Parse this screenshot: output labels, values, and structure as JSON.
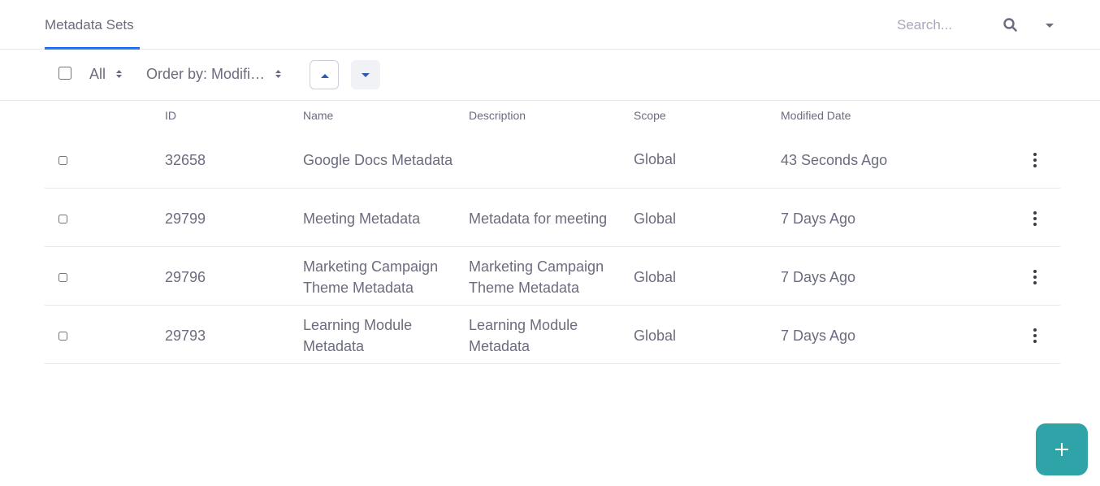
{
  "nav": {
    "tab_label": "Metadata Sets",
    "search_placeholder": "Search..."
  },
  "toolbar": {
    "filter_label": "All",
    "order_label": "Order by: Modifi…"
  },
  "table": {
    "headers": {
      "id": "ID",
      "name": "Name",
      "description": "Description",
      "scope": "Scope",
      "modified": "Modified Date"
    },
    "rows": [
      {
        "id": "32658",
        "name_line1": "Google Docs Metadata",
        "name_line2": "",
        "desc_line1": "",
        "desc_line2": "",
        "scope": "Global",
        "modified": "43 Seconds Ago"
      },
      {
        "id": "29799",
        "name_line1": "Meeting Metadata",
        "name_line2": "",
        "desc_line1": "Metadata for meeting",
        "desc_line2": "",
        "scope": "Global",
        "modified": "7 Days Ago"
      },
      {
        "id": "29796",
        "name_line1": "Marketing Campaign",
        "name_line2": "Theme Metadata",
        "desc_line1": "Marketing Campaign",
        "desc_line2": "Theme Metadata",
        "scope": "Global",
        "modified": "7 Days Ago"
      },
      {
        "id": "29793",
        "name_line1": "Learning Module",
        "name_line2": "Metadata",
        "desc_line1": "Learning Module",
        "desc_line2": "Metadata",
        "scope": "Global",
        "modified": "7 Days Ago"
      }
    ]
  },
  "colors": {
    "text": "#6b6c7e",
    "accent": "#2fa4a8",
    "border": "#e7e7ed"
  }
}
